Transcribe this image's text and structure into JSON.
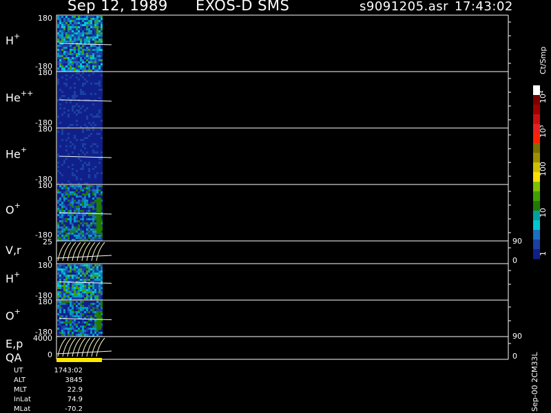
{
  "header": {
    "date": "Sep 12, 1989",
    "instrument": "EXOS-D SMS",
    "file": "s9091205.asr",
    "time": "17:43:02"
  },
  "colorbar": {
    "unit": "Ct/Smp",
    "labels": [
      "10⁴",
      "10³",
      "100",
      "10",
      "1"
    ],
    "colors": [
      "#ffffff",
      "#7a0000",
      "#a00000",
      "#c81010",
      "#e82020",
      "#ff2000",
      "#7a7000",
      "#a09000",
      "#d0c000",
      "#ffe000",
      "#80c000",
      "#40a000",
      "#207a00",
      "#00a0a0",
      "#00c8d0",
      "#1a70c0",
      "#1a40a0",
      "#10208a"
    ]
  },
  "footer_label": "Sep-00 2CM33L",
  "info": [
    {
      "label": "UT",
      "value": "1743:02"
    },
    {
      "label": "ALT",
      "value": "3845"
    },
    {
      "label": "MLT",
      "value": "22.9"
    },
    {
      "label": "InLat",
      "value": "74.9"
    },
    {
      "label": "MLat",
      "value": "-70.2"
    }
  ],
  "chart_data": {
    "type": "heatmap",
    "panels": [
      {
        "id": "h1",
        "label": "H",
        "charge": "+",
        "kind": "spectrogram",
        "ymax": "180",
        "ymin": "-180",
        "intensity": "high"
      },
      {
        "id": "he2",
        "label": "He",
        "charge": "++",
        "kind": "spectrogram",
        "ymax": "180",
        "ymin": "-180",
        "intensity": "low"
      },
      {
        "id": "he1",
        "label": "He",
        "charge": "+",
        "kind": "spectrogram",
        "ymax": "180",
        "ymin": "-180",
        "intensity": "low"
      },
      {
        "id": "o1",
        "label": "O",
        "charge": "+",
        "kind": "spectrogram",
        "ymax": "180",
        "ymin": "-180",
        "intensity": "medium"
      },
      {
        "id": "vr",
        "label": "V,r",
        "charge": "",
        "kind": "curves",
        "ymax": "25",
        "ymin": "0",
        "rmax": "90",
        "rmin": "0"
      },
      {
        "id": "h2",
        "label": "H",
        "charge": "+",
        "kind": "spectrogram",
        "ymax": "180",
        "ymin": "-180",
        "intensity": "high"
      },
      {
        "id": "o2",
        "label": "O",
        "charge": "+",
        "kind": "spectrogram",
        "ymax": "180",
        "ymin": "-180",
        "intensity": "medium"
      },
      {
        "id": "ep",
        "label": "E,p",
        "label2": "QA",
        "charge": "",
        "kind": "curves",
        "ymax": "4000",
        "ymin": "0",
        "rmax": "90",
        "rmin": "0"
      }
    ]
  }
}
